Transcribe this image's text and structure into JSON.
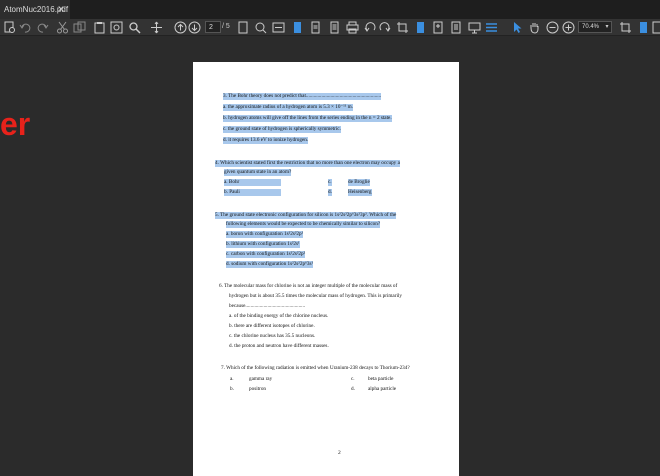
{
  "tab": {
    "title": "AtomNuc2016.pdf",
    "close": "✕"
  },
  "toolbar": {
    "page_current": "2",
    "page_total": "/ 5",
    "zoom": "70.4%",
    "zoom_arrow": "▾"
  },
  "background_text": "er",
  "document": {
    "q3": {
      "stem": "3.   The Bohr theory does not predict that..........................................................",
      "a": "a.  the approximate radius of a hydrogen atom is 5.3 × 10⁻¹¹ m.",
      "b": "b.  hydrogen atoms will give off the lines from the series ending in the n = 2 state.",
      "c": "c.  the ground state of hydrogen is spherically symmetric.",
      "d": "d.  it requires 13.6 eV to ionize hydrogen."
    },
    "q4": {
      "stem1": "4.   Which scientist stated first the restriction that no more than one electron may occupy a",
      "stem2": "given quantum state in an atom?",
      "a": "a.   Bohr",
      "b": "b.   Pauli",
      "c_letter": "c.",
      "c": "de Broglie",
      "d_letter": "d.",
      "d": "Heisenberg"
    },
    "q5": {
      "stem1": "5.   The ground state electronic configuration for silicon is 1s²2s²2p⁶3s²3p². Which of the",
      "stem2": "following elements would be expected to be chemically similar to silicon?",
      "a": "a.   boron with configuration 1s²2s²2p¹",
      "b": "b.   lithium with configuration 1s²2s¹",
      "c": "c.   carbon with configuration 1s²2s²2p²",
      "d": "d.   sodium with configuration 1s²2s²2p⁶3s¹"
    },
    "q6": {
      "stem1": "6.   The molecular mass for chlorine is not an integer multiple of the molecular mass of",
      "stem2": "hydrogen but is about 35.5 times the molecular mass of hydrogen. This is primarily",
      "stem3": "because..............................................",
      "a": "a. of the binding energy of the chlorine nucleus.",
      "b": "b. there are different isotopes of chlorine.",
      "c": "c. the chlorine nucleus has 35.5 nucleons.",
      "d": "d. the proton and neutron have different masses."
    },
    "q7": {
      "stem": "7.   Which of the following radiation is emitted when Uranium-238 decays to Thorium-234?",
      "a_letter": "a.",
      "a": "gamma ray",
      "b_letter": "b.",
      "b": "positron",
      "c_letter": "c.",
      "c": "beta particle",
      "d_letter": "d.",
      "d": "alpha particle"
    },
    "page_number": "2"
  },
  "colors": {
    "highlight": "#a8c8ec",
    "toolbar_bg": "#333333",
    "viewer_bg": "#2b2b2b",
    "accent_blue": "#3b8fe0",
    "red_text": "#e8221b"
  }
}
